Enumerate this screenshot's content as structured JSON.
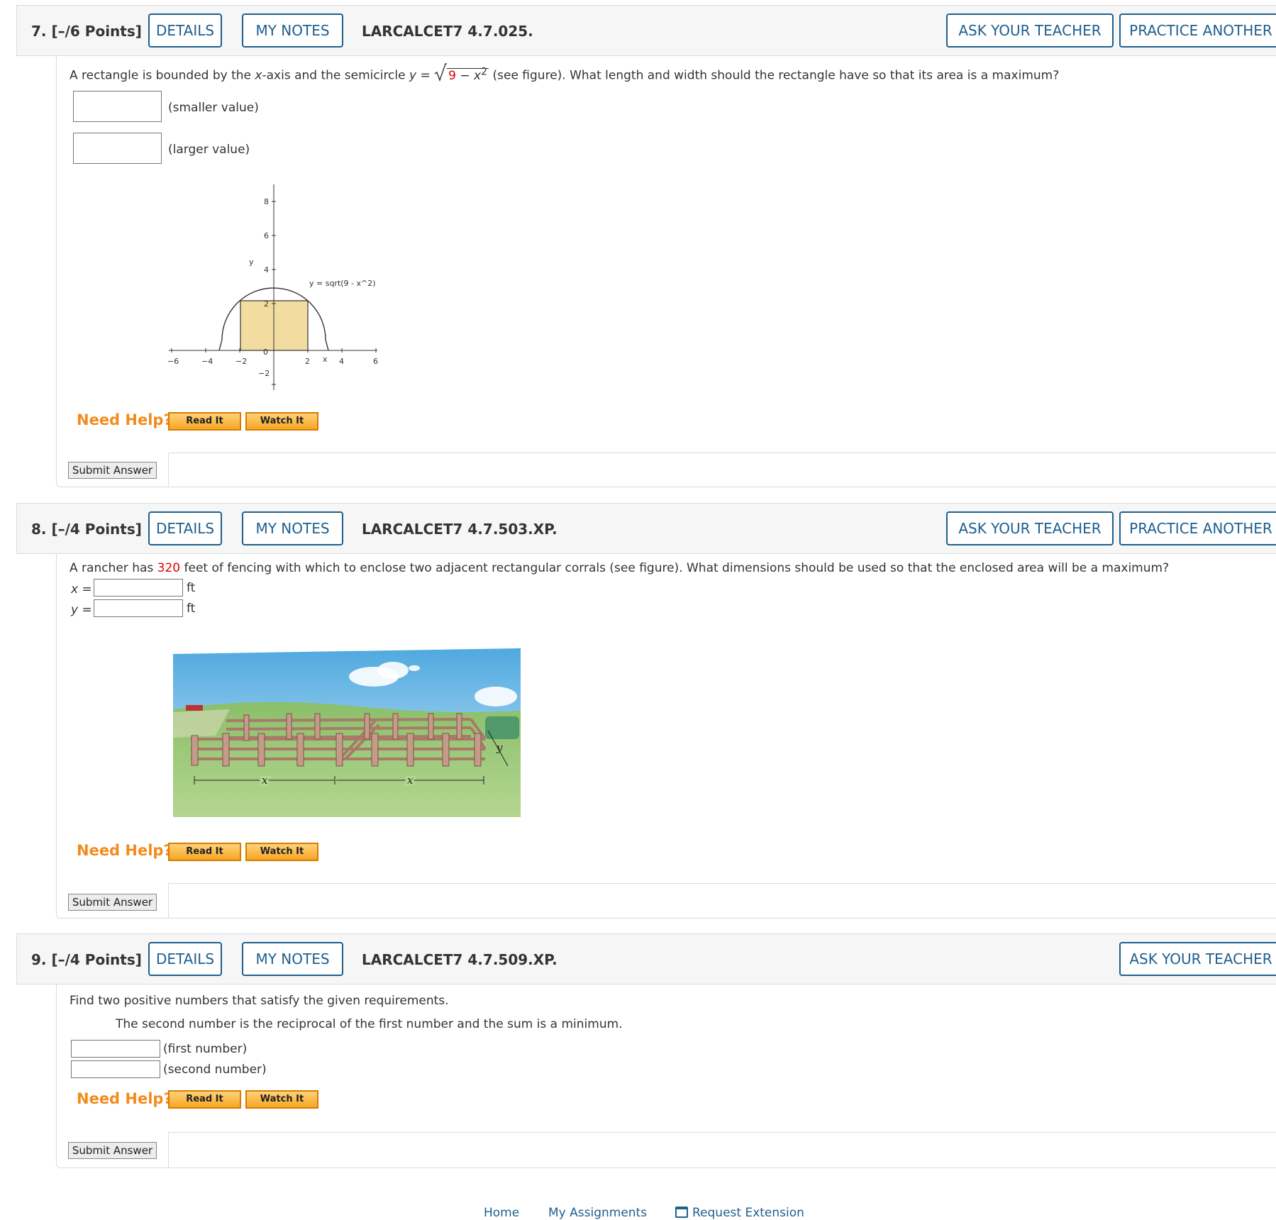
{
  "buttons": {
    "details": "DETAILS",
    "my_notes": "MY NOTES",
    "ask_teacher": "ASK YOUR TEACHER",
    "practice_another": "PRACTICE ANOTHER",
    "need_help": "Need Help?",
    "read_it": "Read It",
    "watch_it": "Watch It",
    "submit": "Submit Answer"
  },
  "q7": {
    "number": "7.  [–/6 Points]",
    "code": "LARCALCET7 4.7.025.",
    "prompt_a": "A rectangle is bounded by the ",
    "prompt_x": "x",
    "prompt_b": "-axis and the semicircle ",
    "prompt_y": "y",
    "prompt_eq": " = ",
    "sqrt_red": "9",
    "sqrt_rest": " − x",
    "sqrt_exp": "2",
    "prompt_c": " (see figure). What length and width should the rectangle have so that its area is a maximum?",
    "label_smaller": "(smaller value)",
    "label_larger": "(larger value)",
    "figure": {
      "y_label": "y",
      "x_label": "x",
      "curve_label": "y = sqrt(9 - x^2)",
      "x_ticks": [
        "−6",
        "−4",
        "−2",
        "0",
        "2",
        "4",
        "6"
      ],
      "y_ticks": [
        "8",
        "6",
        "4",
        "2",
        "−2"
      ]
    }
  },
  "q8": {
    "number": "8.  [–/4 Points]",
    "code": "LARCALCET7 4.7.503.XP.",
    "prompt_a": "A rancher has ",
    "prompt_value": "320",
    "prompt_b": " feet of fencing with which to enclose two adjacent rectangular corrals (see figure). What dimensions should be used so that the enclosed area will be a maximum?",
    "x_label": "x",
    "y_label": "y",
    "eq": " =",
    "unit": "ft",
    "figure": {
      "x_mark": "x",
      "y_mark": "y"
    }
  },
  "q9": {
    "number": "9.  [–/4 Points]",
    "code": "LARCALCET7 4.7.509.XP.",
    "prompt": "Find two positive numbers that satisfy the given requirements.",
    "requirement": "The second number is the reciprocal of the first number and the sum is a minimum.",
    "label_first": "(first number)",
    "label_second": "(second number)"
  },
  "footer": {
    "home": "Home",
    "my_assignments": "My Assignments",
    "request_extension": "Request Extension"
  },
  "colors": {
    "accent": "#1e5f8e",
    "help_orange": "#f28c1e",
    "highlight_red": "#dd0000",
    "rect_fill": "#f3dca0"
  }
}
